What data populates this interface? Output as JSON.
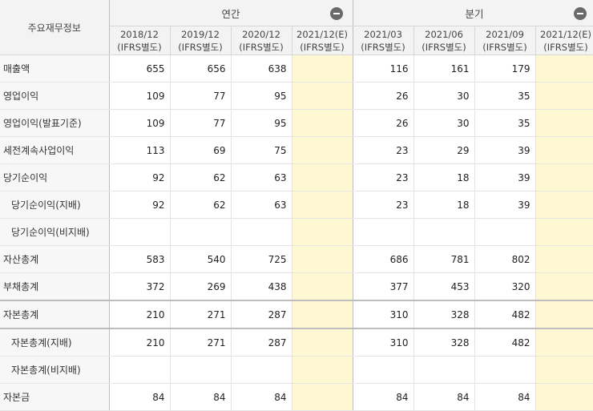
{
  "table": {
    "label_header": "주요재무정보",
    "groups": [
      {
        "label": "연간",
        "toggle_icon": "collapse-minus-icon"
      },
      {
        "label": "분기",
        "toggle_icon": "collapse-minus-icon"
      }
    ],
    "periods": [
      {
        "date": "2018/12",
        "basis": "(IFRS별도)"
      },
      {
        "date": "2019/12",
        "basis": "(IFRS별도)"
      },
      {
        "date": "2020/12",
        "basis": "(IFRS별도)"
      },
      {
        "date": "2021/12(E)",
        "basis": "(IFRS별도)"
      },
      {
        "date": "2021/03",
        "basis": "(IFRS별도)"
      },
      {
        "date": "2021/06",
        "basis": "(IFRS별도)"
      },
      {
        "date": "2021/09",
        "basis": "(IFRS별도)"
      },
      {
        "date": "2021/12(E)",
        "basis": "(IFRS별도)"
      }
    ],
    "estimate_color": "#fdf7d2",
    "rows": [
      {
        "label": "매출액",
        "values": [
          "655",
          "656",
          "638",
          "",
          "116",
          "161",
          "179",
          ""
        ]
      },
      {
        "label": "영업이익",
        "values": [
          "109",
          "77",
          "95",
          "",
          "26",
          "30",
          "35",
          ""
        ]
      },
      {
        "label": "영업이익(발표기준)",
        "values": [
          "109",
          "77",
          "95",
          "",
          "26",
          "30",
          "35",
          ""
        ]
      },
      {
        "label": "세전계속사업이익",
        "values": [
          "113",
          "69",
          "75",
          "",
          "23",
          "29",
          "39",
          ""
        ]
      },
      {
        "label": "당기순이익",
        "values": [
          "92",
          "62",
          "63",
          "",
          "23",
          "18",
          "39",
          ""
        ]
      },
      {
        "label": "당기순이익(지배)",
        "values": [
          "92",
          "62",
          "63",
          "",
          "23",
          "18",
          "39",
          ""
        ]
      },
      {
        "label": "당기순이익(비지배)",
        "values": [
          "",
          "",
          "",
          "",
          "",
          "",
          "",
          ""
        ]
      },
      {
        "label": "자산총계",
        "values": [
          "583",
          "540",
          "725",
          "",
          "686",
          "781",
          "802",
          ""
        ]
      },
      {
        "label": "부채총계",
        "values": [
          "372",
          "269",
          "438",
          "",
          "377",
          "453",
          "320",
          ""
        ]
      },
      {
        "label": "자본총계",
        "values": [
          "210",
          "271",
          "287",
          "",
          "310",
          "328",
          "482",
          ""
        ]
      },
      {
        "label": "자본총계(지배)",
        "values": [
          "210",
          "271",
          "287",
          "",
          "310",
          "328",
          "482",
          ""
        ]
      },
      {
        "label": "자본총계(비지배)",
        "values": [
          "",
          "",
          "",
          "",
          "",
          "",
          "",
          ""
        ]
      },
      {
        "label": "자본금",
        "values": [
          "84",
          "84",
          "84",
          "",
          "84",
          "84",
          "84",
          ""
        ]
      }
    ]
  }
}
